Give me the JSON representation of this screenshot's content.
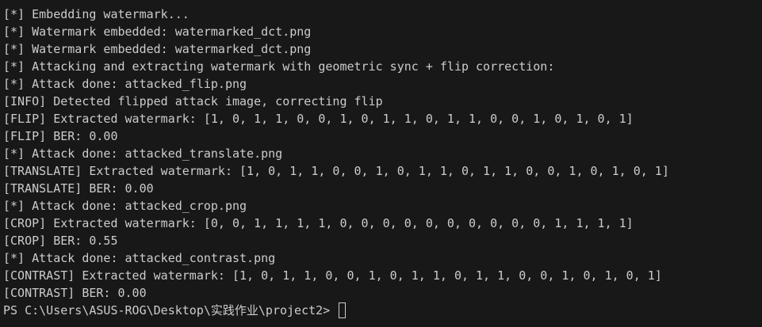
{
  "terminal": {
    "lines": [
      "[*] Embedding watermark...",
      "[*] Watermark embedded: watermarked_dct.png",
      "[*] Watermark embedded: watermarked_dct.png",
      "[*] Attacking and extracting watermark with geometric sync + flip correction:",
      "[*] Attack done: attacked_flip.png",
      "[INFO] Detected flipped attack image, correcting flip",
      "[FLIP] Extracted watermark: [1, 0, 1, 1, 0, 0, 1, 0, 1, 1, 0, 1, 1, 0, 0, 1, 0, 1, 0, 1]",
      "[FLIP] BER: 0.00",
      "[*] Attack done: attacked_translate.png",
      "[TRANSLATE] Extracted watermark: [1, 0, 1, 1, 0, 0, 1, 0, 1, 1, 0, 1, 1, 0, 0, 1, 0, 1, 0, 1]",
      "[TRANSLATE] BER: 0.00",
      "[*] Attack done: attacked_crop.png",
      "[CROP] Extracted watermark: [0, 0, 1, 1, 1, 1, 0, 0, 0, 0, 0, 0, 0, 0, 0, 0, 1, 1, 1, 1]",
      "[CROP] BER: 0.55",
      "[*] Attack done: attacked_contrast.png",
      "[CONTRAST] Extracted watermark: [1, 0, 1, 1, 0, 0, 1, 0, 1, 1, 0, 1, 1, 0, 0, 1, 0, 1, 0, 1]",
      "[CONTRAST] BER: 0.00"
    ],
    "prompt": "PS C:\\Users\\ASUS-ROG\\Desktop\\实践作业\\project2> ",
    "colors": {
      "background": "#181818",
      "text": "#cccccc"
    }
  }
}
